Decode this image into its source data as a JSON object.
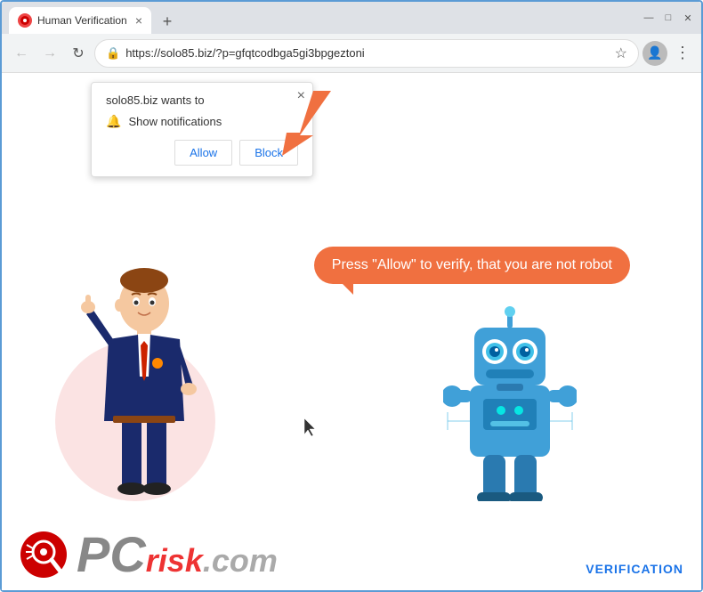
{
  "browser": {
    "title": "Human Verification",
    "url": "https://solo85.biz/?p=gfqtcodbga5gi3bpgeztoni",
    "tab_close": "×",
    "new_tab": "+",
    "window_minimize": "—",
    "window_maximize": "□",
    "window_close": "✕"
  },
  "popup": {
    "site_name": "solo85.biz wants to",
    "notification_label": "Show notifications",
    "close": "×",
    "allow_button": "Allow",
    "block_button": "Block"
  },
  "page": {
    "speech_text": "Press \"Allow\" to verify, that you are not robot",
    "verification_label": "VERIFICATION"
  },
  "pcrisk": {
    "pc": "PC",
    "risk": "risk",
    "dotcom": ".com"
  }
}
